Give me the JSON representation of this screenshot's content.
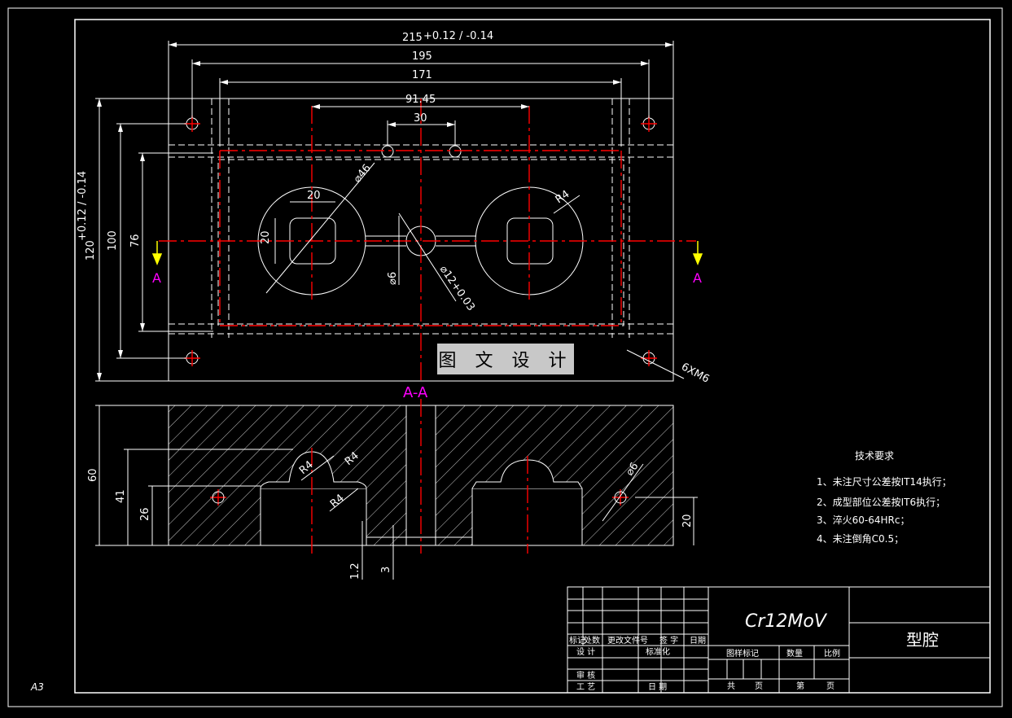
{
  "sheet": {
    "size_label": "A3",
    "watermark": "图 文 设 计"
  },
  "plan_view": {
    "dims": {
      "overall_width": "215",
      "overall_width_tol": "+0.12 / -0.14",
      "hole_pitch_x": "195",
      "pitch_x": "171",
      "cavity_pitch": "91.45",
      "gate_width": "30",
      "overall_height": "120",
      "overall_height_tol": "+0.12 / -0.14",
      "hole_pitch_y": "100",
      "slot_pitch_y": "76",
      "dia_46": "⌀46",
      "dim_20_top": "20",
      "dim_20_side": "20",
      "radius_r4": "R4",
      "dia_6": "⌀6",
      "dia_12": "⌀12+0.03",
      "thread": "6XM6"
    },
    "section_marker_left": "A",
    "section_marker_right": "A"
  },
  "section_view": {
    "title": "A-A",
    "dims": {
      "height_60": "60",
      "height_41": "41",
      "height_26": "26",
      "height_20": "20",
      "dim_12": "1.2",
      "dim_3": "3",
      "r4_a": "R4",
      "r4_b": "R4",
      "r4_c": "R4",
      "dia_6": "⌀6"
    }
  },
  "tech_requirements": {
    "title": "技术要求",
    "items": [
      "1、未注尺寸公差按IT14执行；",
      "2、成型部位公差按IT6执行；",
      "3、淬火60-64HRc；",
      "4、未注倒角C0.5；"
    ]
  },
  "title_block": {
    "material": "Cr12MoV",
    "part_name": "型腔",
    "labels": {
      "mark": "标记",
      "count": "处数",
      "change_doc": "更改文件号",
      "sign": "签 字",
      "date": "日期",
      "design": "设 计",
      "standardize": "标准化",
      "drawing_mark": "图样标记",
      "quantity": "数量",
      "scale": "比例",
      "review": "审 核",
      "process": "工 艺",
      "date2": "日 期",
      "total": "共",
      "page": "页",
      "sheet_no": "第",
      "page2": "页"
    }
  },
  "colors": {
    "background": "#000000",
    "outline": "#ffffff",
    "centerline": "#ff0000",
    "section_marker": "#ff00ff",
    "arrow": "#ffff00"
  }
}
